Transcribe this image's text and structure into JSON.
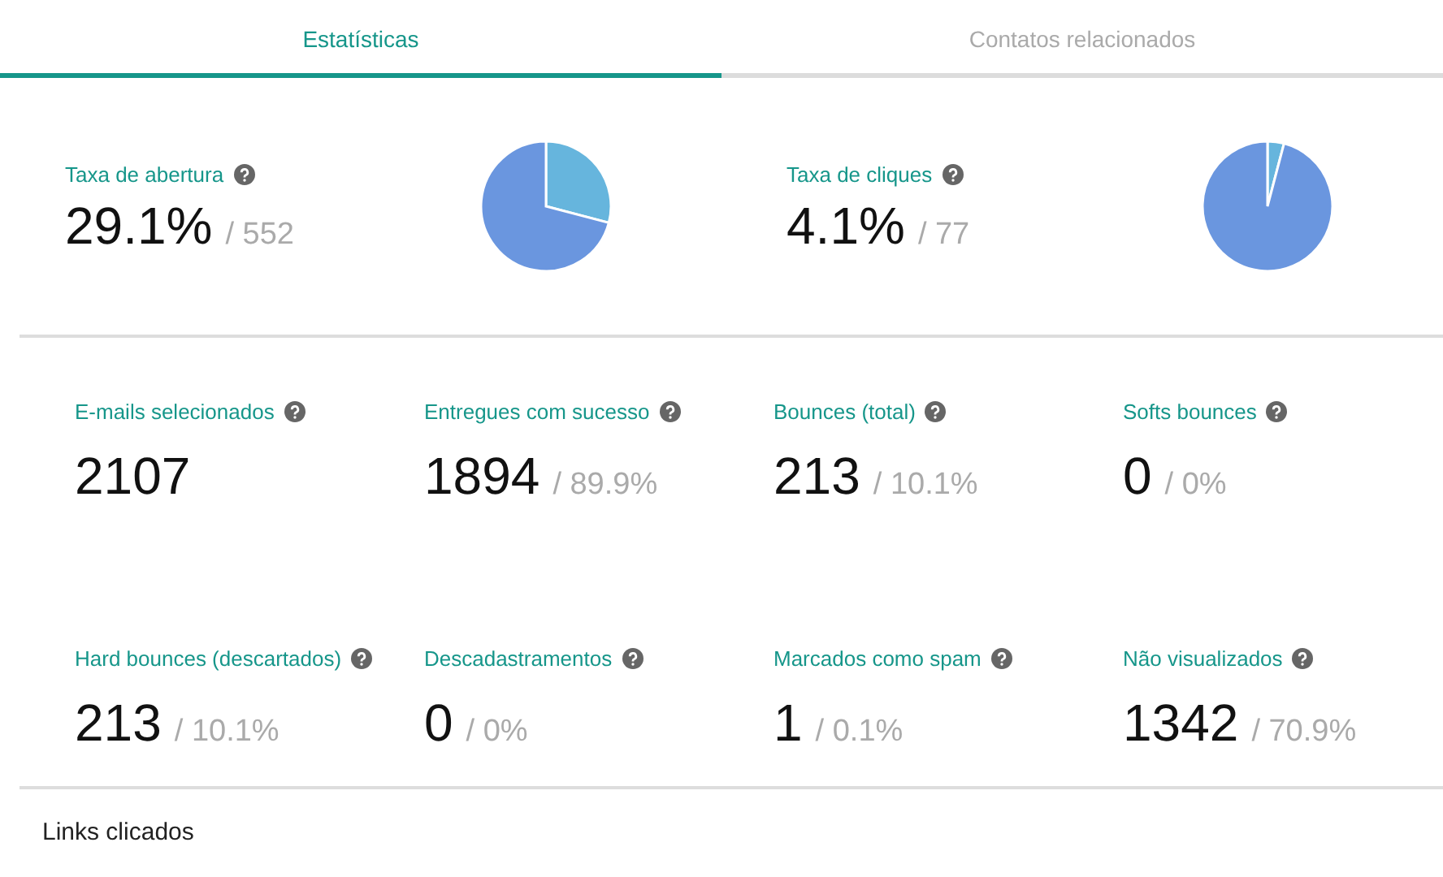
{
  "tabs": [
    {
      "label": "Estatísticas",
      "selected": true
    },
    {
      "label": "Contatos relacionados",
      "selected": false
    }
  ],
  "highlights": [
    {
      "label": "Taxa de abertura",
      "value": "29.1%",
      "detail": "/ 552",
      "chart_data": {
        "type": "pie",
        "values": [
          29.1,
          70.9
        ]
      }
    },
    {
      "label": "Taxa de cliques",
      "value": "4.1%",
      "detail": "/ 77",
      "chart_data": {
        "type": "pie",
        "values": [
          4.1,
          95.9
        ]
      }
    }
  ],
  "metrics": [
    {
      "label": "E-mails selecionados",
      "value": "2107"
    },
    {
      "label": "Entregues com sucesso",
      "value": "1894",
      "detail": "/ 89.9%"
    },
    {
      "label": "Bounces (total)",
      "value": "213",
      "detail": "/ 10.1%"
    },
    {
      "label": "Softs bounces",
      "value": "0",
      "detail": "/ 0%"
    },
    {
      "label": "Hard bounces (descartados)",
      "value": "213",
      "detail": "/ 10.1%"
    },
    {
      "label": "Descadastramentos",
      "value": "0",
      "detail": "/ 0%"
    },
    {
      "label": "Marcados como spam",
      "value": "1",
      "detail": "/ 0.1%"
    },
    {
      "label": "Não visualizados",
      "value": "1342",
      "detail": "/ 70.9%"
    }
  ],
  "section_title": "Links clicados"
}
